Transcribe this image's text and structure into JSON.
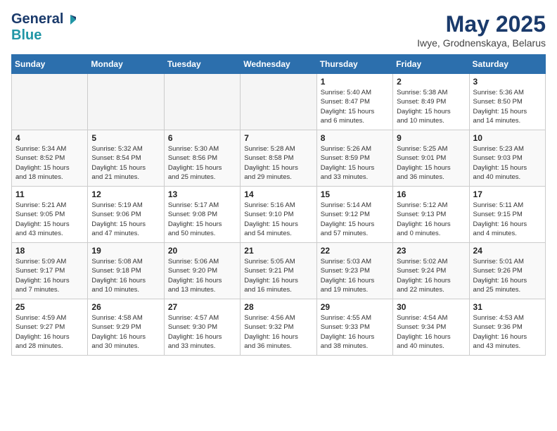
{
  "logo": {
    "general": "General",
    "blue": "Blue"
  },
  "title": "May 2025",
  "location": "Iwye, Grodnenskaya, Belarus",
  "days_of_week": [
    "Sunday",
    "Monday",
    "Tuesday",
    "Wednesday",
    "Thursday",
    "Friday",
    "Saturday"
  ],
  "weeks": [
    {
      "days": [
        {
          "num": "",
          "info": ""
        },
        {
          "num": "",
          "info": ""
        },
        {
          "num": "",
          "info": ""
        },
        {
          "num": "",
          "info": ""
        },
        {
          "num": "1",
          "info": "Sunrise: 5:40 AM\nSunset: 8:47 PM\nDaylight: 15 hours\nand 6 minutes."
        },
        {
          "num": "2",
          "info": "Sunrise: 5:38 AM\nSunset: 8:49 PM\nDaylight: 15 hours\nand 10 minutes."
        },
        {
          "num": "3",
          "info": "Sunrise: 5:36 AM\nSunset: 8:50 PM\nDaylight: 15 hours\nand 14 minutes."
        }
      ]
    },
    {
      "days": [
        {
          "num": "4",
          "info": "Sunrise: 5:34 AM\nSunset: 8:52 PM\nDaylight: 15 hours\nand 18 minutes."
        },
        {
          "num": "5",
          "info": "Sunrise: 5:32 AM\nSunset: 8:54 PM\nDaylight: 15 hours\nand 21 minutes."
        },
        {
          "num": "6",
          "info": "Sunrise: 5:30 AM\nSunset: 8:56 PM\nDaylight: 15 hours\nand 25 minutes."
        },
        {
          "num": "7",
          "info": "Sunrise: 5:28 AM\nSunset: 8:58 PM\nDaylight: 15 hours\nand 29 minutes."
        },
        {
          "num": "8",
          "info": "Sunrise: 5:26 AM\nSunset: 8:59 PM\nDaylight: 15 hours\nand 33 minutes."
        },
        {
          "num": "9",
          "info": "Sunrise: 5:25 AM\nSunset: 9:01 PM\nDaylight: 15 hours\nand 36 minutes."
        },
        {
          "num": "10",
          "info": "Sunrise: 5:23 AM\nSunset: 9:03 PM\nDaylight: 15 hours\nand 40 minutes."
        }
      ]
    },
    {
      "days": [
        {
          "num": "11",
          "info": "Sunrise: 5:21 AM\nSunset: 9:05 PM\nDaylight: 15 hours\nand 43 minutes."
        },
        {
          "num": "12",
          "info": "Sunrise: 5:19 AM\nSunset: 9:06 PM\nDaylight: 15 hours\nand 47 minutes."
        },
        {
          "num": "13",
          "info": "Sunrise: 5:17 AM\nSunset: 9:08 PM\nDaylight: 15 hours\nand 50 minutes."
        },
        {
          "num": "14",
          "info": "Sunrise: 5:16 AM\nSunset: 9:10 PM\nDaylight: 15 hours\nand 54 minutes."
        },
        {
          "num": "15",
          "info": "Sunrise: 5:14 AM\nSunset: 9:12 PM\nDaylight: 15 hours\nand 57 minutes."
        },
        {
          "num": "16",
          "info": "Sunrise: 5:12 AM\nSunset: 9:13 PM\nDaylight: 16 hours\nand 0 minutes."
        },
        {
          "num": "17",
          "info": "Sunrise: 5:11 AM\nSunset: 9:15 PM\nDaylight: 16 hours\nand 4 minutes."
        }
      ]
    },
    {
      "days": [
        {
          "num": "18",
          "info": "Sunrise: 5:09 AM\nSunset: 9:17 PM\nDaylight: 16 hours\nand 7 minutes."
        },
        {
          "num": "19",
          "info": "Sunrise: 5:08 AM\nSunset: 9:18 PM\nDaylight: 16 hours\nand 10 minutes."
        },
        {
          "num": "20",
          "info": "Sunrise: 5:06 AM\nSunset: 9:20 PM\nDaylight: 16 hours\nand 13 minutes."
        },
        {
          "num": "21",
          "info": "Sunrise: 5:05 AM\nSunset: 9:21 PM\nDaylight: 16 hours\nand 16 minutes."
        },
        {
          "num": "22",
          "info": "Sunrise: 5:03 AM\nSunset: 9:23 PM\nDaylight: 16 hours\nand 19 minutes."
        },
        {
          "num": "23",
          "info": "Sunrise: 5:02 AM\nSunset: 9:24 PM\nDaylight: 16 hours\nand 22 minutes."
        },
        {
          "num": "24",
          "info": "Sunrise: 5:01 AM\nSunset: 9:26 PM\nDaylight: 16 hours\nand 25 minutes."
        }
      ]
    },
    {
      "days": [
        {
          "num": "25",
          "info": "Sunrise: 4:59 AM\nSunset: 9:27 PM\nDaylight: 16 hours\nand 28 minutes."
        },
        {
          "num": "26",
          "info": "Sunrise: 4:58 AM\nSunset: 9:29 PM\nDaylight: 16 hours\nand 30 minutes."
        },
        {
          "num": "27",
          "info": "Sunrise: 4:57 AM\nSunset: 9:30 PM\nDaylight: 16 hours\nand 33 minutes."
        },
        {
          "num": "28",
          "info": "Sunrise: 4:56 AM\nSunset: 9:32 PM\nDaylight: 16 hours\nand 36 minutes."
        },
        {
          "num": "29",
          "info": "Sunrise: 4:55 AM\nSunset: 9:33 PM\nDaylight: 16 hours\nand 38 minutes."
        },
        {
          "num": "30",
          "info": "Sunrise: 4:54 AM\nSunset: 9:34 PM\nDaylight: 16 hours\nand 40 minutes."
        },
        {
          "num": "31",
          "info": "Sunrise: 4:53 AM\nSunset: 9:36 PM\nDaylight: 16 hours\nand 43 minutes."
        }
      ]
    }
  ]
}
